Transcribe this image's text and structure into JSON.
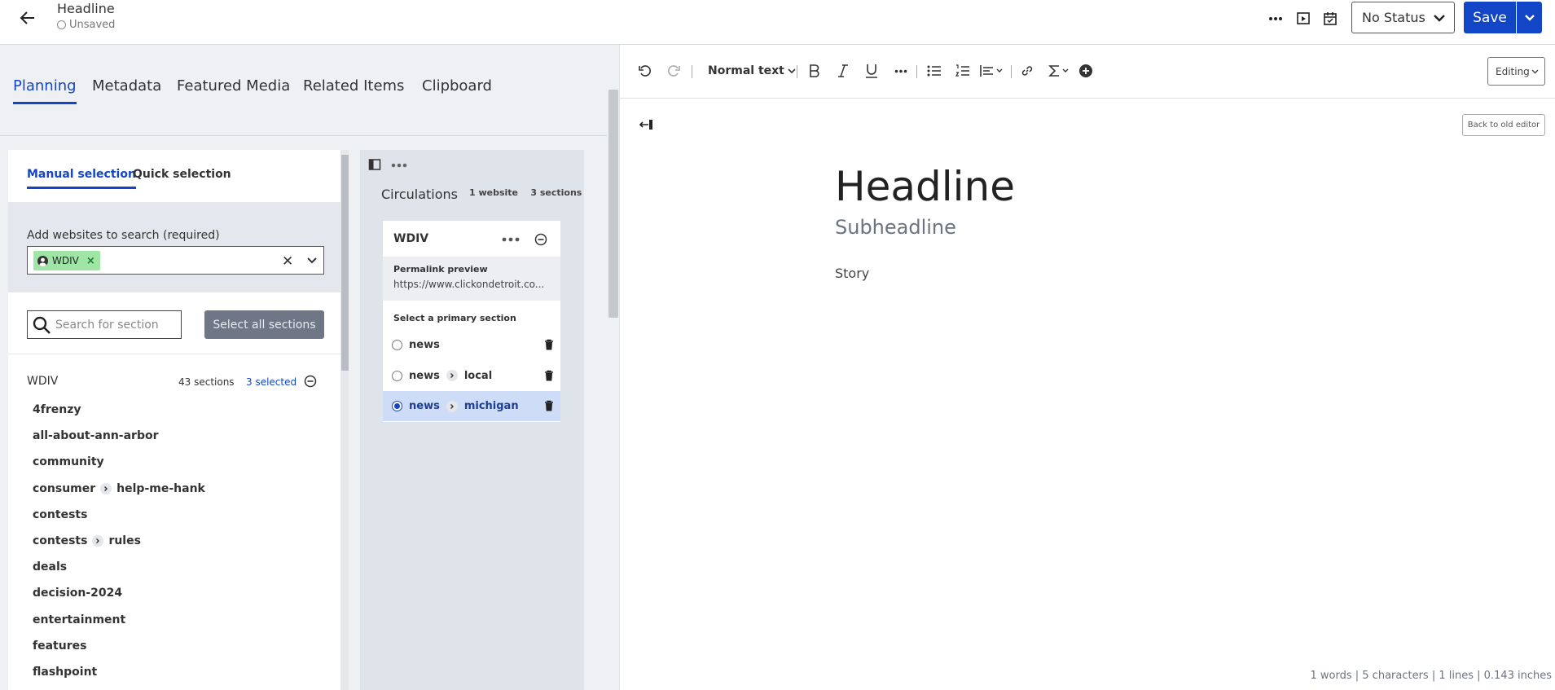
{
  "header": {
    "title": "Headline",
    "status": "Unsaved",
    "status_select": "No Status",
    "save_label": "Save"
  },
  "left_panel": {
    "tabs": [
      {
        "label": "Planning",
        "active": true
      },
      {
        "label": "Metadata",
        "active": false
      },
      {
        "label": "Featured Media",
        "active": false
      },
      {
        "label": "Related Items",
        "active": false
      },
      {
        "label": "Clipboard",
        "active": false
      }
    ],
    "search": {
      "subtabs": [
        {
          "label": "Manual selection",
          "active": true
        },
        {
          "label": "Quick selection",
          "active": false
        }
      ],
      "websites_label": "Add websites to search (required)",
      "website_chip": "WDIV",
      "section_search_placeholder": "Search for section",
      "select_all_label": "Select all sections",
      "group": {
        "name": "WDIV",
        "count": "43 sections",
        "selected": "3 selected"
      },
      "sections": [
        [
          "4frenzy"
        ],
        [
          "all-about-ann-arbor"
        ],
        [
          "community"
        ],
        [
          "consumer",
          "help-me-hank"
        ],
        [
          "contests"
        ],
        [
          "contests",
          "rules"
        ],
        [
          "deals"
        ],
        [
          "decision-2024"
        ],
        [
          "entertainment"
        ],
        [
          "features"
        ],
        [
          "flashpoint"
        ]
      ]
    },
    "circulations": {
      "title": "Circulations",
      "websites_count": "1 website",
      "sections_count": "3 sections",
      "site": "WDIV",
      "permalink_label": "Permalink preview",
      "permalink_url": "https://www.clickondetroit.co...",
      "primary_label": "Select a primary section",
      "primary_sections": [
        {
          "path": [
            "news"
          ],
          "selected": false
        },
        {
          "path": [
            "news",
            "local"
          ],
          "selected": false
        },
        {
          "path": [
            "news",
            "michigan"
          ],
          "selected": true
        }
      ]
    }
  },
  "editor": {
    "toolbar": {
      "text_style": "Normal text",
      "mode": "Editing"
    },
    "old_editor_label": "Back to old editor",
    "headline": "Headline",
    "subheadline": "Subheadline",
    "story": "Story",
    "stats": "1 words | 5 characters | 1 lines | 0.143 inches"
  },
  "colors": {
    "accent": "#1346c7",
    "chip": "#9fe5a6",
    "selected_row": "#cfdcf7"
  },
  "icons": [
    "arrow-left-icon",
    "more-icon",
    "preview-icon",
    "calendar-icon",
    "chevron-down-icon",
    "undo-icon",
    "redo-icon",
    "bold-icon",
    "italic-icon",
    "underline-icon",
    "bullet-list-icon",
    "numbered-list-icon",
    "align-icon",
    "link-icon",
    "sigma-icon",
    "plus-circle-icon",
    "trash-icon",
    "search-icon",
    "sidebar-toggle-icon",
    "minus-circle-icon"
  ]
}
